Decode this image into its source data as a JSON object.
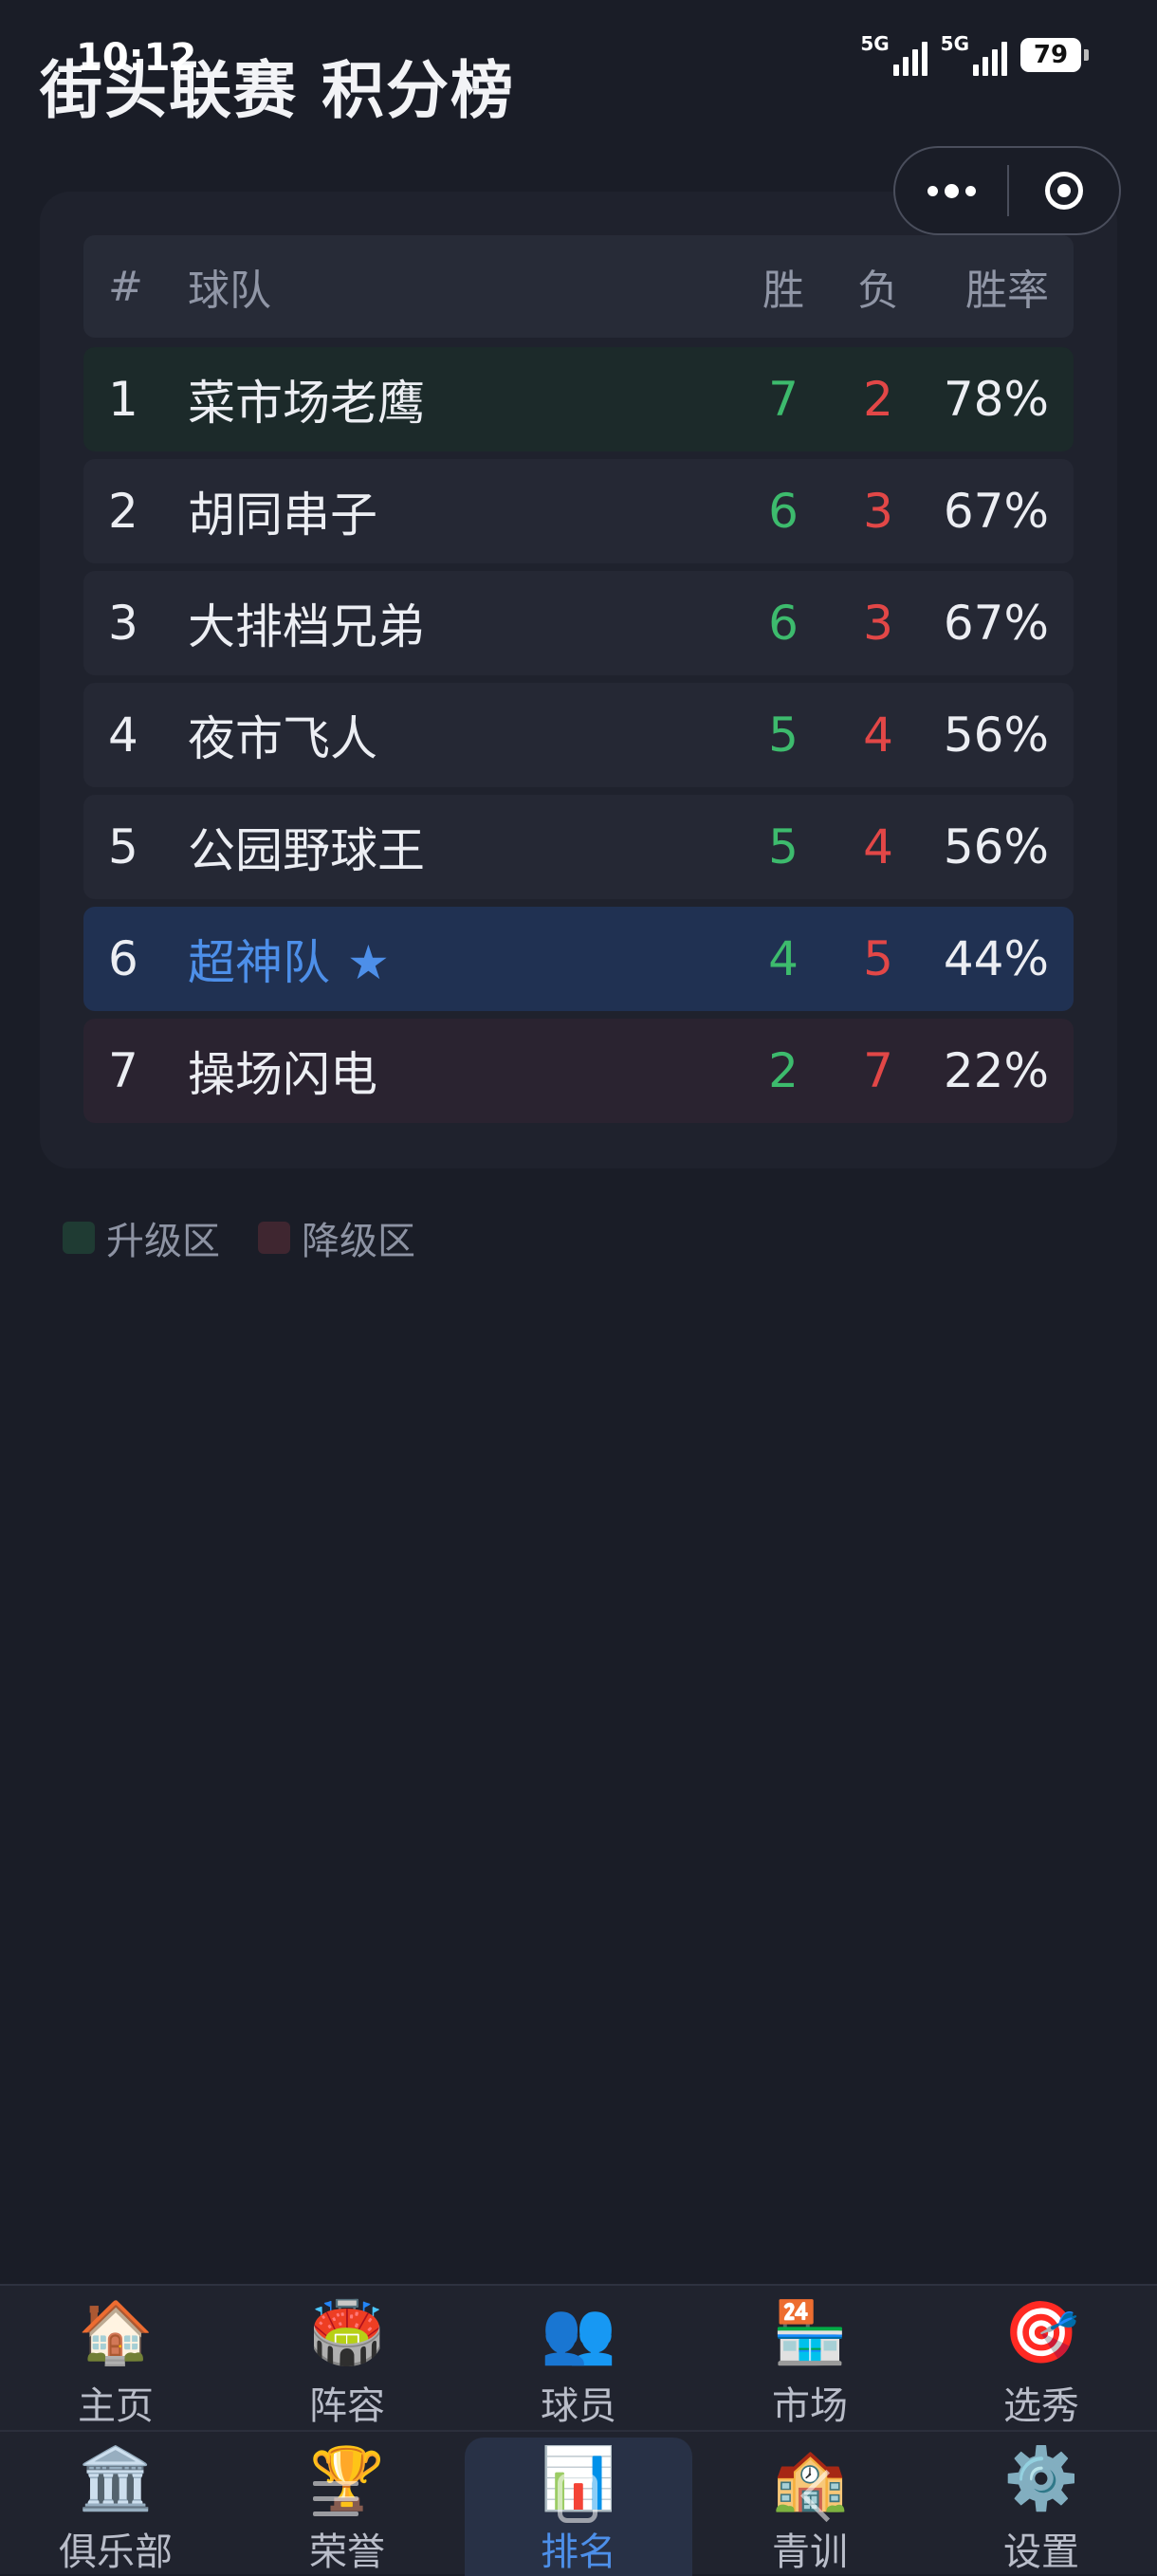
{
  "status_bar": {
    "time": "10:12",
    "network_1": "5G",
    "network_2": "5G",
    "battery": "79"
  },
  "header": {
    "title": "街头联赛 积分榜"
  },
  "capsule": {
    "more_icon": "ellipsis-icon",
    "close_icon": "target-circle-icon"
  },
  "table": {
    "headers": {
      "rank": "#",
      "team": "球队",
      "wins": "胜",
      "losses": "负",
      "win_rate": "胜率"
    },
    "rows": [
      {
        "rank": "1",
        "team": "菜市场老鹰",
        "wins": "7",
        "losses": "2",
        "win_rate": "78%",
        "zone": "promotion"
      },
      {
        "rank": "2",
        "team": "胡同串子",
        "wins": "6",
        "losses": "3",
        "win_rate": "67%",
        "zone": "none"
      },
      {
        "rank": "3",
        "team": "大排档兄弟",
        "wins": "6",
        "losses": "3",
        "win_rate": "67%",
        "zone": "none"
      },
      {
        "rank": "4",
        "team": "夜市飞人",
        "wins": "5",
        "losses": "4",
        "win_rate": "56%",
        "zone": "none"
      },
      {
        "rank": "5",
        "team": "公园野球王",
        "wins": "5",
        "losses": "4",
        "win_rate": "56%",
        "zone": "none"
      },
      {
        "rank": "6",
        "team": "超神队",
        "team_marker": "★",
        "wins": "4",
        "losses": "5",
        "win_rate": "44%",
        "zone": "mine"
      },
      {
        "rank": "7",
        "team": "操场闪电",
        "wins": "2",
        "losses": "7",
        "win_rate": "22%",
        "zone": "relegation"
      }
    ]
  },
  "legend": {
    "promotion_label": "升级区",
    "relegation_label": "降级区",
    "promotion_color": "#1f3b33",
    "relegation_color": "#3f2630"
  },
  "colors": {
    "win": "#3dbb6d",
    "loss": "#e24747",
    "highlight": "#4d8fe9",
    "background": "#1a1d27"
  },
  "nav": {
    "row1": [
      {
        "label": "主页",
        "icon": "house-icon",
        "glyph": "🏠"
      },
      {
        "label": "阵容",
        "icon": "stadium-icon",
        "glyph": "🏟️"
      },
      {
        "label": "球员",
        "icon": "players-icon",
        "glyph": "👥"
      },
      {
        "label": "市场",
        "icon": "store-24-icon",
        "glyph": "🏪"
      },
      {
        "label": "选秀",
        "icon": "target-icon",
        "glyph": "🎯"
      }
    ],
    "row2": [
      {
        "label": "俱乐部",
        "icon": "clubhouse-icon",
        "glyph": "🏛️"
      },
      {
        "label": "荣誉",
        "icon": "trophy-icon",
        "glyph": "🏆"
      },
      {
        "label": "排名",
        "icon": "bar-chart-icon",
        "glyph": "📊",
        "active": true
      },
      {
        "label": "青训",
        "icon": "school-icon",
        "glyph": "🏫"
      },
      {
        "label": "设置",
        "icon": "gear-icon",
        "glyph": "⚙️"
      }
    ]
  }
}
